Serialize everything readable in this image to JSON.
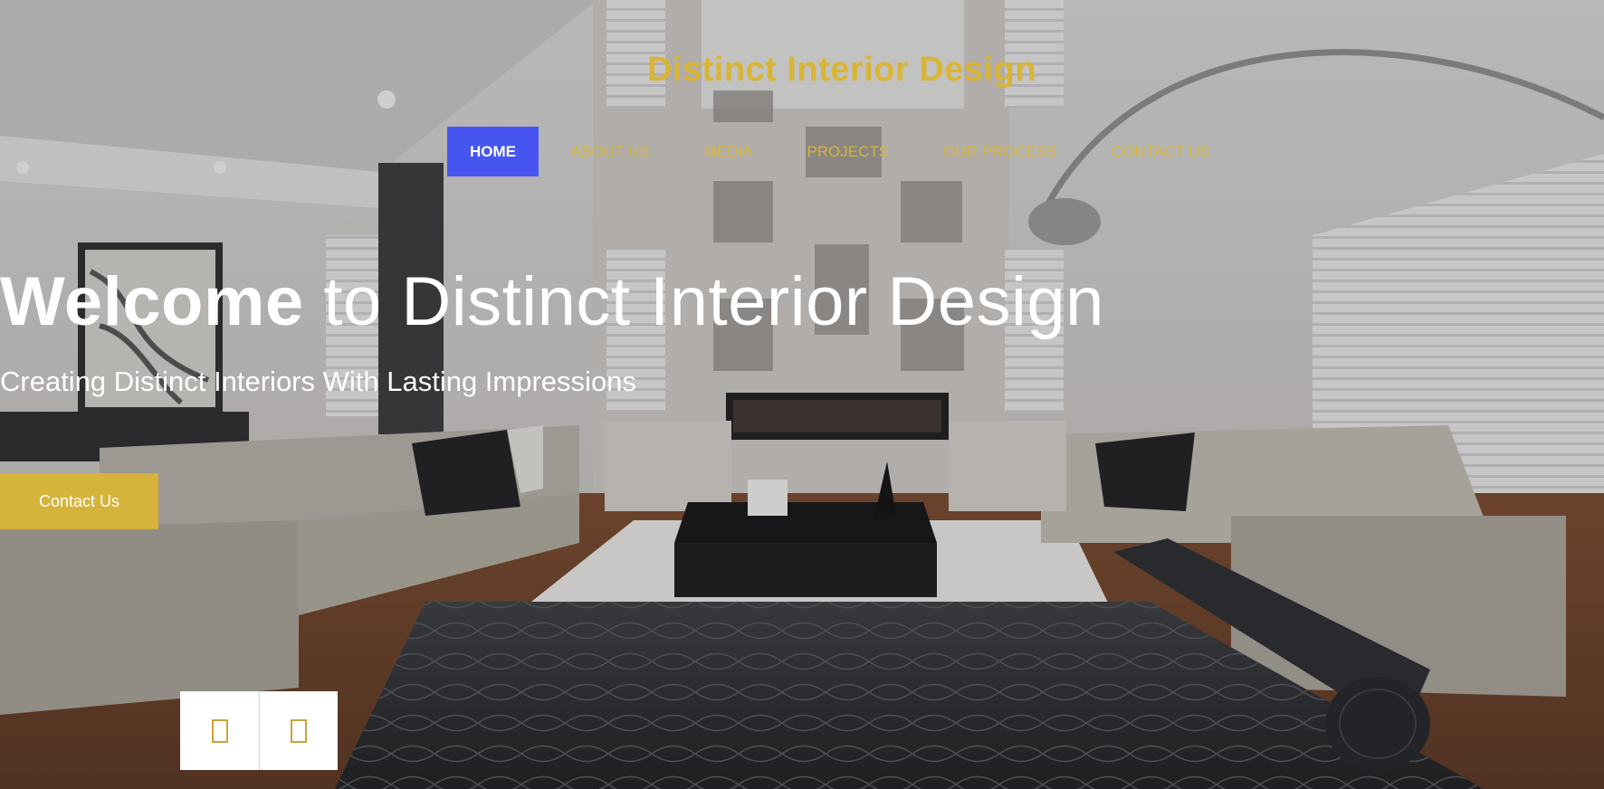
{
  "site": {
    "title": "Distinct Interior Design"
  },
  "nav": {
    "items": [
      {
        "label": "HOME",
        "active": true
      },
      {
        "label": "ABOUT US"
      },
      {
        "label": "MEDIA"
      },
      {
        "label": "PROJECTS"
      },
      {
        "label": "OUR PROCESS"
      },
      {
        "label": "CONTACT US"
      }
    ]
  },
  "hero": {
    "heading_strong": "Welcome",
    "heading_rest": " to Distinct Interior Design",
    "subheading": "Creating Distinct Interiors With Lasting Impressions",
    "cta_label": "Contact Us",
    "background_icon": "living-room-photo"
  },
  "slider": {
    "prev_icon": "arrow-left-icon",
    "next_icon": "arrow-right-icon"
  },
  "colors": {
    "accent": "#dab533",
    "nav_active": "#4655f0",
    "cta": "#d6b33a",
    "text": "#ffffff"
  }
}
